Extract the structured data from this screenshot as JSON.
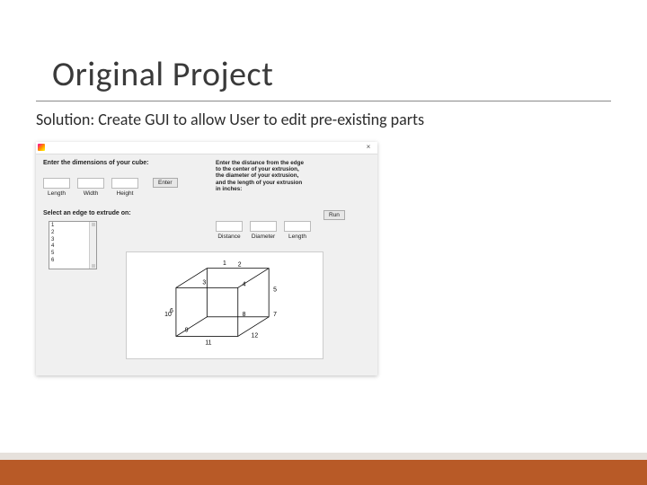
{
  "title": "Original Project",
  "subtitle": "Solution: Create GUI to allow User to edit pre-existing parts",
  "gui": {
    "instruction_left": "Enter the dimensions of your cube:",
    "instruction_right": "Enter the distance from the edge to the center of your extrusion, the diameter of your extrusion, and the length of your extrusion in inches:",
    "cube_fields": {
      "length_label": "Length",
      "width_label": "Width",
      "height_label": "Height"
    },
    "enter_button": "Enter",
    "edge_select_label": "Select an edge to extrude on:",
    "listbox_items": [
      "1",
      "2",
      "3",
      "4",
      "5",
      "6"
    ],
    "extrusion_fields": {
      "distance_label": "Distance",
      "diameter_label": "Diameter",
      "length_label": "Length"
    },
    "run_button": "Run",
    "cube_edge_labels": [
      "1",
      "2",
      "3",
      "4",
      "5",
      "6",
      "7",
      "8",
      "9",
      "10",
      "11",
      "12"
    ]
  }
}
